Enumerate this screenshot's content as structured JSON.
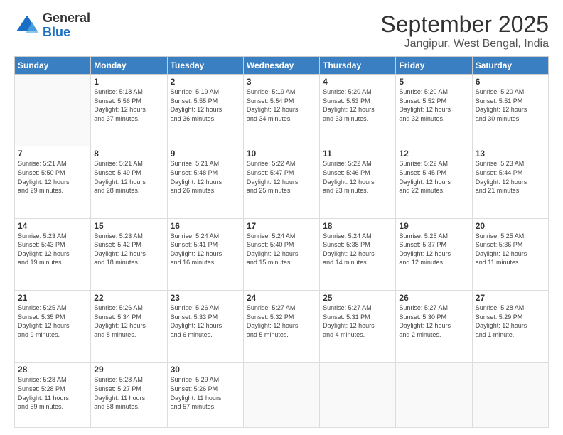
{
  "logo": {
    "general": "General",
    "blue": "Blue"
  },
  "header": {
    "month": "September 2025",
    "location": "Jangipur, West Bengal, India"
  },
  "days_of_week": [
    "Sunday",
    "Monday",
    "Tuesday",
    "Wednesday",
    "Thursday",
    "Friday",
    "Saturday"
  ],
  "weeks": [
    [
      {
        "day": "",
        "info": ""
      },
      {
        "day": "1",
        "info": "Sunrise: 5:18 AM\nSunset: 5:56 PM\nDaylight: 12 hours\nand 37 minutes."
      },
      {
        "day": "2",
        "info": "Sunrise: 5:19 AM\nSunset: 5:55 PM\nDaylight: 12 hours\nand 36 minutes."
      },
      {
        "day": "3",
        "info": "Sunrise: 5:19 AM\nSunset: 5:54 PM\nDaylight: 12 hours\nand 34 minutes."
      },
      {
        "day": "4",
        "info": "Sunrise: 5:20 AM\nSunset: 5:53 PM\nDaylight: 12 hours\nand 33 minutes."
      },
      {
        "day": "5",
        "info": "Sunrise: 5:20 AM\nSunset: 5:52 PM\nDaylight: 12 hours\nand 32 minutes."
      },
      {
        "day": "6",
        "info": "Sunrise: 5:20 AM\nSunset: 5:51 PM\nDaylight: 12 hours\nand 30 minutes."
      }
    ],
    [
      {
        "day": "7",
        "info": "Sunrise: 5:21 AM\nSunset: 5:50 PM\nDaylight: 12 hours\nand 29 minutes."
      },
      {
        "day": "8",
        "info": "Sunrise: 5:21 AM\nSunset: 5:49 PM\nDaylight: 12 hours\nand 28 minutes."
      },
      {
        "day": "9",
        "info": "Sunrise: 5:21 AM\nSunset: 5:48 PM\nDaylight: 12 hours\nand 26 minutes."
      },
      {
        "day": "10",
        "info": "Sunrise: 5:22 AM\nSunset: 5:47 PM\nDaylight: 12 hours\nand 25 minutes."
      },
      {
        "day": "11",
        "info": "Sunrise: 5:22 AM\nSunset: 5:46 PM\nDaylight: 12 hours\nand 23 minutes."
      },
      {
        "day": "12",
        "info": "Sunrise: 5:22 AM\nSunset: 5:45 PM\nDaylight: 12 hours\nand 22 minutes."
      },
      {
        "day": "13",
        "info": "Sunrise: 5:23 AM\nSunset: 5:44 PM\nDaylight: 12 hours\nand 21 minutes."
      }
    ],
    [
      {
        "day": "14",
        "info": "Sunrise: 5:23 AM\nSunset: 5:43 PM\nDaylight: 12 hours\nand 19 minutes."
      },
      {
        "day": "15",
        "info": "Sunrise: 5:23 AM\nSunset: 5:42 PM\nDaylight: 12 hours\nand 18 minutes."
      },
      {
        "day": "16",
        "info": "Sunrise: 5:24 AM\nSunset: 5:41 PM\nDaylight: 12 hours\nand 16 minutes."
      },
      {
        "day": "17",
        "info": "Sunrise: 5:24 AM\nSunset: 5:40 PM\nDaylight: 12 hours\nand 15 minutes."
      },
      {
        "day": "18",
        "info": "Sunrise: 5:24 AM\nSunset: 5:38 PM\nDaylight: 12 hours\nand 14 minutes."
      },
      {
        "day": "19",
        "info": "Sunrise: 5:25 AM\nSunset: 5:37 PM\nDaylight: 12 hours\nand 12 minutes."
      },
      {
        "day": "20",
        "info": "Sunrise: 5:25 AM\nSunset: 5:36 PM\nDaylight: 12 hours\nand 11 minutes."
      }
    ],
    [
      {
        "day": "21",
        "info": "Sunrise: 5:25 AM\nSunset: 5:35 PM\nDaylight: 12 hours\nand 9 minutes."
      },
      {
        "day": "22",
        "info": "Sunrise: 5:26 AM\nSunset: 5:34 PM\nDaylight: 12 hours\nand 8 minutes."
      },
      {
        "day": "23",
        "info": "Sunrise: 5:26 AM\nSunset: 5:33 PM\nDaylight: 12 hours\nand 6 minutes."
      },
      {
        "day": "24",
        "info": "Sunrise: 5:27 AM\nSunset: 5:32 PM\nDaylight: 12 hours\nand 5 minutes."
      },
      {
        "day": "25",
        "info": "Sunrise: 5:27 AM\nSunset: 5:31 PM\nDaylight: 12 hours\nand 4 minutes."
      },
      {
        "day": "26",
        "info": "Sunrise: 5:27 AM\nSunset: 5:30 PM\nDaylight: 12 hours\nand 2 minutes."
      },
      {
        "day": "27",
        "info": "Sunrise: 5:28 AM\nSunset: 5:29 PM\nDaylight: 12 hours\nand 1 minute."
      }
    ],
    [
      {
        "day": "28",
        "info": "Sunrise: 5:28 AM\nSunset: 5:28 PM\nDaylight: 11 hours\nand 59 minutes."
      },
      {
        "day": "29",
        "info": "Sunrise: 5:28 AM\nSunset: 5:27 PM\nDaylight: 11 hours\nand 58 minutes."
      },
      {
        "day": "30",
        "info": "Sunrise: 5:29 AM\nSunset: 5:26 PM\nDaylight: 11 hours\nand 57 minutes."
      },
      {
        "day": "",
        "info": ""
      },
      {
        "day": "",
        "info": ""
      },
      {
        "day": "",
        "info": ""
      },
      {
        "day": "",
        "info": ""
      }
    ]
  ]
}
